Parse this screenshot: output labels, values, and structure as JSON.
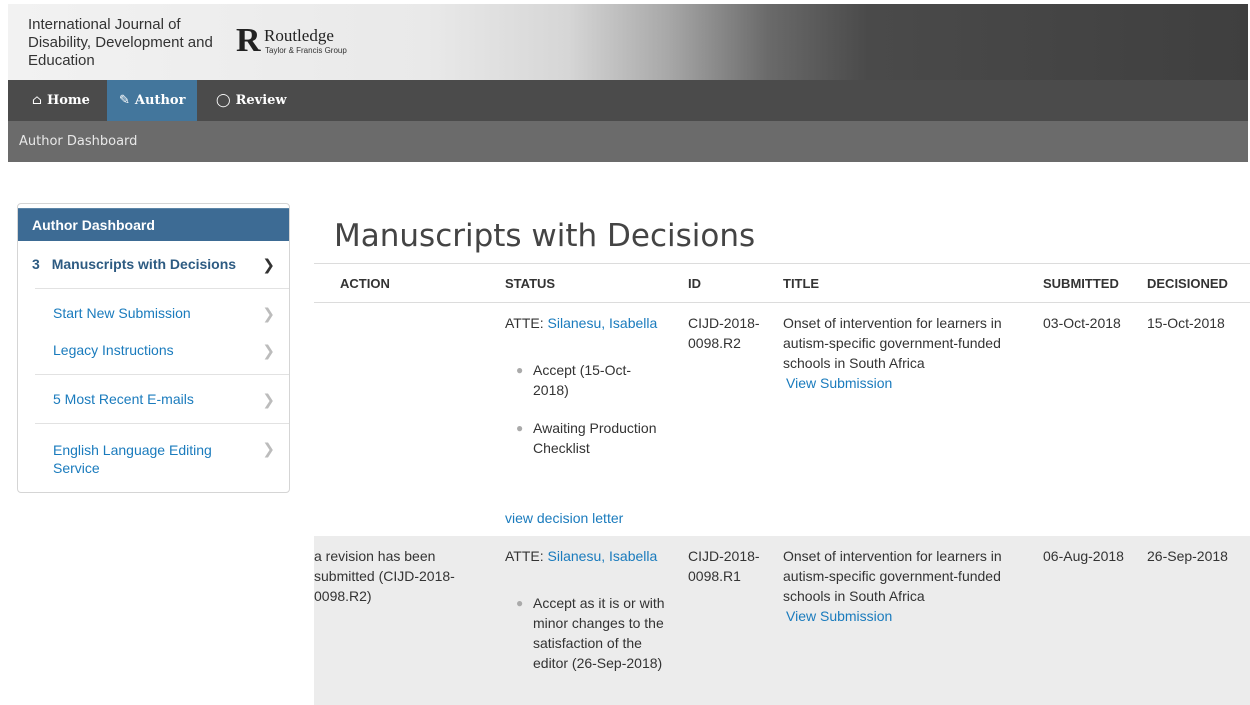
{
  "header": {
    "journal_title": "International Journal of Disability, Development and Education",
    "publisher_name": "Routledge",
    "publisher_sub": "Taylor & Francis Group",
    "logo_glyph": "R"
  },
  "nav": {
    "home": "Home",
    "author": "Author",
    "review": "Review",
    "home_icon": "home-icon",
    "author_icon": "pencil-icon",
    "review_icon": "comment-icon"
  },
  "subnav": {
    "label": "Author Dashboard"
  },
  "sidebar": {
    "heading": "Author Dashboard",
    "active_count": "3",
    "active_label": "Manuscripts with Decisions",
    "items": [
      {
        "label": "Start New Submission"
      },
      {
        "label": "Legacy Instructions"
      },
      {
        "label": "5 Most Recent E-mails"
      },
      {
        "label": "English Language Editing Service"
      }
    ]
  },
  "main": {
    "title": "Manuscripts with Decisions",
    "columns": [
      "ACTION",
      "STATUS",
      "ID",
      "TITLE",
      "SUBMITTED",
      "DECISIONED"
    ],
    "rows": [
      {
        "action": "",
        "status_prefix": "ATTE:",
        "status_person": "Silanesu, Isabella",
        "status_items": [
          "Accept (15-Oct-2018)",
          "Awaiting Production Checklist"
        ],
        "decision_link": "view decision letter",
        "id": "CIJD-2018-0098.R2",
        "title": "Onset of intervention for learners in autism-specific government-funded schools in South Africa",
        "view_link": "View Submission",
        "submitted": "03-Oct-2018",
        "decisioned": "15-Oct-2018"
      },
      {
        "action": "a revision has been submitted (CIJD-2018-0098.R2)",
        "status_prefix": "ATTE:",
        "status_person": "Silanesu, Isabella",
        "status_items": [
          "Accept as it is or with minor changes to the satisfaction of the editor (26-Sep-2018)"
        ],
        "id": "CIJD-2018-0098.R1",
        "title": "Onset of intervention for learners in autism-specific government-funded schools in South Africa",
        "view_link": "View Submission",
        "submitted": "06-Aug-2018",
        "decisioned": "26-Sep-2018"
      }
    ]
  },
  "colors": {
    "accent": "#43769c",
    "sidebar_head": "#3d6b94",
    "link": "#1a7bbd",
    "nav_bg": "#4b4b4b",
    "subnav_bg": "#6b6b6b"
  }
}
